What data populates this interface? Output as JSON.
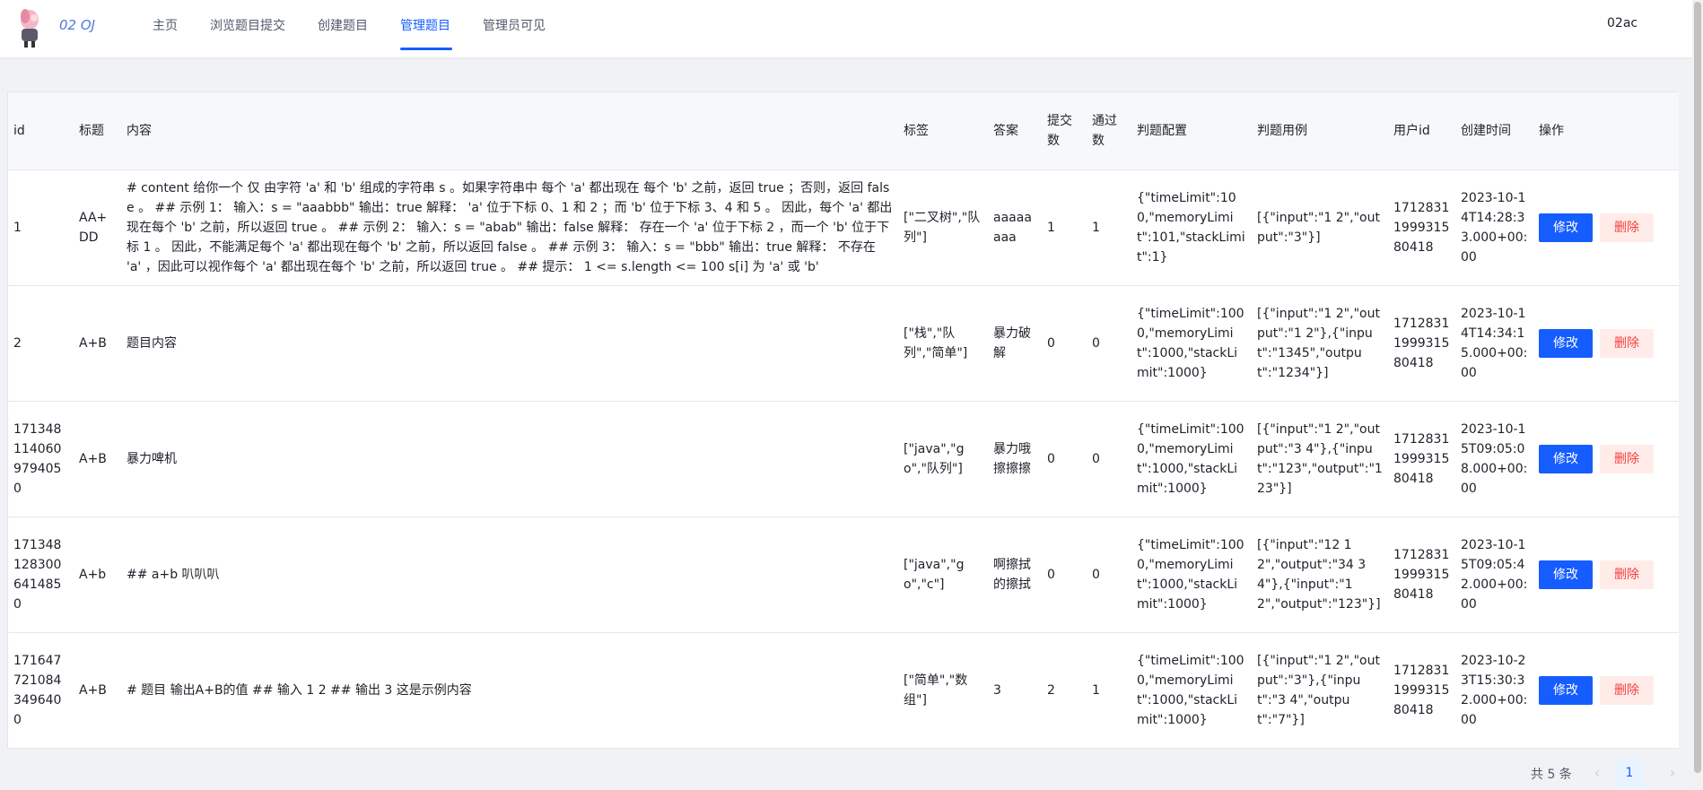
{
  "header": {
    "brand": "02 OJ",
    "nav": [
      "主页",
      "浏览题目提交",
      "创建题目",
      "管理题目",
      "管理员可见"
    ],
    "active_nav": "管理题目",
    "user": "02ac"
  },
  "colors": {
    "accent": "#165dff",
    "danger": "#f53f3f",
    "danger_bg": "#ffece8"
  },
  "table": {
    "columns": [
      "id",
      "标题",
      "内容",
      "标签",
      "答案",
      "提交数",
      "通过数",
      "判题配置",
      "判题用例",
      "用户id",
      "创建时间",
      "操作"
    ],
    "edit_label": "修改",
    "delete_label": "删除",
    "rows": [
      {
        "id": "1",
        "title": "AA+DD",
        "content": "# content 给你一个 仅 由字符 'a' 和 'b' 组成的字符串 s 。如果字符串中 每个 'a' 都出现在 每个 'b' 之前，返回 true ；否则，返回 false 。 ## 示例 1： 输入：s = \"aaabbb\" 输出：true 解释： 'a' 位于下标 0、1 和 2 ；而 'b' 位于下标 3、4 和 5 。 因此，每个 'a' 都出现在每个 'b' 之前，所以返回 true 。 ## 示例 2： 输入：s = \"abab\" 输出：false 解释： 存在一个 'a' 位于下标 2 ，而一个 'b' 位于下标 1 。 因此，不能满足每个 'a' 都出现在每个 'b' 之前，所以返回 false 。 ## 示例 3： 输入：s = \"bbb\" 输出：true 解释： 不存在 'a' ，因此可以视作每个 'a' 都出现在每个 'b' 之前，所以返回 true 。 ## 提示： 1 <= s.length <= 100 s[i] 为 'a' 或 'b'",
        "tags": "[\"二叉树\",\"队列\"]",
        "answer": "aaaaaaaa",
        "submit": "1",
        "accepted": "1",
        "judge_config": "{\"timeLimit\":100,\"memoryLimit\":101,\"stackLimit\":1}",
        "judge_case": "[{\"input\":\"1 2\",\"output\":\"3\"}]",
        "user_id": "1712831199931580418",
        "created": "2023-10-14T14:28:33.000+00:00"
      },
      {
        "id": "2",
        "title": "A+B",
        "content": "题目内容",
        "tags": "[\"栈\",\"队列\",\"简单\"]",
        "answer": "暴力破解",
        "submit": "0",
        "accepted": "0",
        "judge_config": "{\"timeLimit\":1000,\"memoryLimit\":1000,\"stackLimit\":1000}",
        "judge_case": "[{\"input\":\"1 2\",\"output\":\"1 2\"},{\"input\":\"1345\",\"output\":\"1234\"}]",
        "user_id": "1712831199931580418",
        "created": "2023-10-14T14:34:15.000+00:00"
      },
      {
        "id": "1713481140609794050",
        "title": "A+B",
        "content": "暴力啤机",
        "tags": "[\"java\",\"go\",\"队列\"]",
        "answer": "暴力哦擦擦擦",
        "submit": "0",
        "accepted": "0",
        "judge_config": "{\"timeLimit\":1000,\"memoryLimit\":1000,\"stackLimit\":1000}",
        "judge_case": "[{\"input\":\"1 2\",\"output\":\"3 4\"},{\"input\":\"123\",\"output\":\"123\"}]",
        "user_id": "1712831199931580418",
        "created": "2023-10-15T09:05:08.000+00:00"
      },
      {
        "id": "1713481283006414850",
        "title": "A+b",
        "content": "## a+b 叭叭叭",
        "tags": "[\"java\",\"go\",\"c\"]",
        "answer": "啊擦拭的擦拭",
        "submit": "0",
        "accepted": "0",
        "judge_config": "{\"timeLimit\":1000,\"memoryLimit\":1000,\"stackLimit\":1000}",
        "judge_case": "[{\"input\":\"12 12\",\"output\":\"34 34\"},{\"input\":\"12\",\"output\":\"123\"}]",
        "user_id": "1712831199931580418",
        "created": "2023-10-15T09:05:42.000+00:00"
      },
      {
        "id": "1716477210843496400",
        "title": "A+B",
        "content": "# 题目 输出A+B的值 ## 输入 1 2 ## 输出 3 这是示例内容",
        "tags": "[\"简单\",\"数组\"]",
        "answer": "3",
        "submit": "2",
        "accepted": "1",
        "judge_config": "{\"timeLimit\":1000,\"memoryLimit\":1000,\"stackLimit\":1000}",
        "judge_case": "[{\"input\":\"1 2\",\"output\":\"3\"},{\"input\":\"3 4\",\"output\":\"7\"}]",
        "user_id": "1712831199931580418",
        "created": "2023-10-23T15:30:32.000+00:00"
      }
    ]
  },
  "pagination": {
    "total_label": "共 5 条",
    "current_page": "1",
    "prev_icon": "chevron-left-icon",
    "next_icon": "chevron-right-icon"
  }
}
